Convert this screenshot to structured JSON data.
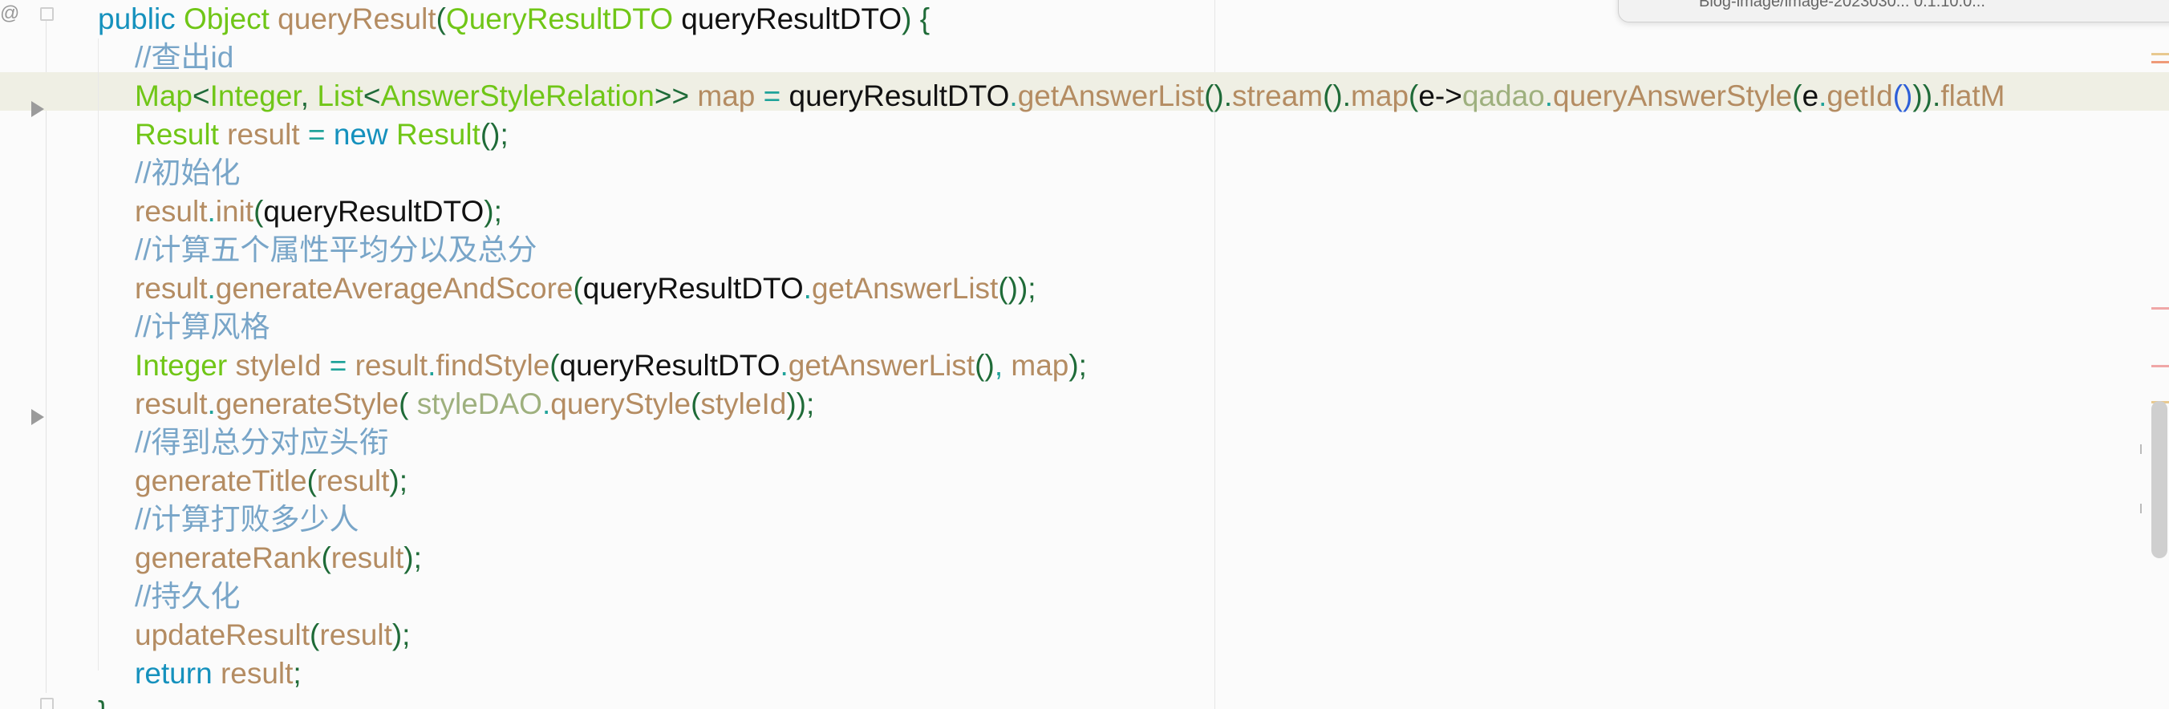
{
  "editor": {
    "lines": [
      [
        {
          "text": "public ",
          "cls": "kw"
        },
        {
          "text": "Object ",
          "cls": "type"
        },
        {
          "text": "queryResult",
          "cls": "method"
        },
        {
          "text": "(",
          "cls": "paren"
        },
        {
          "text": "QueryResultDTO ",
          "cls": "type"
        },
        {
          "text": "queryResultDTO",
          "cls": "plain"
        },
        {
          "text": ") {",
          "cls": "paren"
        }
      ],
      [
        {
          "text": "//查出id",
          "cls": "comment"
        }
      ],
      [
        {
          "text": "Map",
          "cls": "type"
        },
        {
          "text": "<",
          "cls": "paren"
        },
        {
          "text": "Integer",
          "cls": "type"
        },
        {
          "text": ", ",
          "cls": "paren"
        },
        {
          "text": "List",
          "cls": "type"
        },
        {
          "text": "<",
          "cls": "paren"
        },
        {
          "text": "AnswerStyleRelation",
          "cls": "type"
        },
        {
          "text": ">> ",
          "cls": "paren"
        },
        {
          "text": "map ",
          "cls": "var"
        },
        {
          "text": "= ",
          "cls": "op"
        },
        {
          "text": "queryResultDTO",
          "cls": "plain"
        },
        {
          "text": ".",
          "cls": "op"
        },
        {
          "text": "getAnswerList",
          "cls": "method"
        },
        {
          "text": "().",
          "cls": "paren"
        },
        {
          "text": "stream",
          "cls": "method"
        },
        {
          "text": "().",
          "cls": "paren"
        },
        {
          "text": "map",
          "cls": "method"
        },
        {
          "text": "(",
          "cls": "paren"
        },
        {
          "text": "e->",
          "cls": "plain"
        },
        {
          "text": "qadao",
          "cls": "muted-var"
        },
        {
          "text": ".",
          "cls": "op"
        },
        {
          "text": "queryAnswerStyle",
          "cls": "method"
        },
        {
          "text": "(",
          "cls": "paren"
        },
        {
          "text": "e",
          "cls": "plain"
        },
        {
          "text": ".",
          "cls": "op"
        },
        {
          "text": "getId",
          "cls": "method"
        },
        {
          "text": "()",
          "cls": "blue-paren"
        },
        {
          "text": ")).",
          "cls": "paren"
        },
        {
          "text": "flatM",
          "cls": "method"
        }
      ],
      [
        {
          "text": "Result ",
          "cls": "type"
        },
        {
          "text": "result ",
          "cls": "var"
        },
        {
          "text": "= ",
          "cls": "op"
        },
        {
          "text": "new ",
          "cls": "kw"
        },
        {
          "text": "Result",
          "cls": "type"
        },
        {
          "text": "();",
          "cls": "paren"
        }
      ],
      [
        {
          "text": "//初始化",
          "cls": "comment"
        }
      ],
      [
        {
          "text": "result",
          "cls": "var"
        },
        {
          "text": ".",
          "cls": "op"
        },
        {
          "text": "init",
          "cls": "method"
        },
        {
          "text": "(",
          "cls": "paren"
        },
        {
          "text": "queryResultDTO",
          "cls": "plain"
        },
        {
          "text": ");",
          "cls": "paren"
        }
      ],
      [
        {
          "text": "//计算五个属性平均分以及总分",
          "cls": "comment"
        }
      ],
      [
        {
          "text": "result",
          "cls": "var"
        },
        {
          "text": ".",
          "cls": "op"
        },
        {
          "text": "generateAverageAndScore",
          "cls": "method"
        },
        {
          "text": "(",
          "cls": "paren"
        },
        {
          "text": "queryResultDTO",
          "cls": "plain"
        },
        {
          "text": ".",
          "cls": "op"
        },
        {
          "text": "getAnswerList",
          "cls": "method"
        },
        {
          "text": "());",
          "cls": "paren"
        }
      ],
      [
        {
          "text": "//计算风格",
          "cls": "comment"
        }
      ],
      [
        {
          "text": "Integer ",
          "cls": "type"
        },
        {
          "text": "styleId ",
          "cls": "var"
        },
        {
          "text": "= ",
          "cls": "op"
        },
        {
          "text": "result",
          "cls": "var"
        },
        {
          "text": ".",
          "cls": "op"
        },
        {
          "text": "findStyle",
          "cls": "method"
        },
        {
          "text": "(",
          "cls": "paren"
        },
        {
          "text": "queryResultDTO",
          "cls": "plain"
        },
        {
          "text": ".",
          "cls": "op"
        },
        {
          "text": "getAnswerList",
          "cls": "method"
        },
        {
          "text": "()",
          "cls": "paren"
        },
        {
          "text": ", ",
          "cls": "op"
        },
        {
          "text": "map",
          "cls": "var"
        },
        {
          "text": ");",
          "cls": "paren"
        }
      ],
      [
        {
          "text": "result",
          "cls": "var"
        },
        {
          "text": ".",
          "cls": "op"
        },
        {
          "text": "generateStyle",
          "cls": "method"
        },
        {
          "text": "( ",
          "cls": "paren"
        },
        {
          "text": "styleDAO",
          "cls": "muted-var"
        },
        {
          "text": ".",
          "cls": "op"
        },
        {
          "text": "queryStyle",
          "cls": "method"
        },
        {
          "text": "(",
          "cls": "paren"
        },
        {
          "text": "styleId",
          "cls": "var"
        },
        {
          "text": "));",
          "cls": "paren"
        }
      ],
      [
        {
          "text": "//得到总分对应头衔",
          "cls": "comment"
        }
      ],
      [
        {
          "text": "generateTitle",
          "cls": "method"
        },
        {
          "text": "(",
          "cls": "paren"
        },
        {
          "text": "result",
          "cls": "var"
        },
        {
          "text": ");",
          "cls": "paren"
        }
      ],
      [
        {
          "text": "//计算打败多少人",
          "cls": "comment"
        }
      ],
      [
        {
          "text": "generateRank",
          "cls": "method"
        },
        {
          "text": "(",
          "cls": "paren"
        },
        {
          "text": "result",
          "cls": "var"
        },
        {
          "text": ");",
          "cls": "paren"
        }
      ],
      [
        {
          "text": "//持久化",
          "cls": "comment"
        }
      ],
      [
        {
          "text": "updateResult",
          "cls": "method"
        },
        {
          "text": "(",
          "cls": "paren"
        },
        {
          "text": "result",
          "cls": "var"
        },
        {
          "text": ");",
          "cls": "paren"
        }
      ],
      [
        {
          "text": "return ",
          "cls": "kw"
        },
        {
          "text": "result",
          "cls": "var"
        },
        {
          "text": ";",
          "cls": "paren"
        }
      ],
      [
        {
          "text": "}",
          "cls": "paren"
        }
      ]
    ],
    "gutter": {
      "annotation_icon": "@",
      "icons": [
        "annotation-icon",
        "fold-marker-icon",
        "collapse-arrow-icon"
      ]
    },
    "tooltip_text": "Blog-image/image-2023030... 0.1.10.0...",
    "colors": {
      "background": "#fbfbfb",
      "keyword": "#1591bd",
      "type": "#70c617",
      "method": "#b48c62",
      "comment": "#78a5c8",
      "operator": "#20a39a",
      "plain": "#111111",
      "current_line": "#efefe4"
    }
  }
}
